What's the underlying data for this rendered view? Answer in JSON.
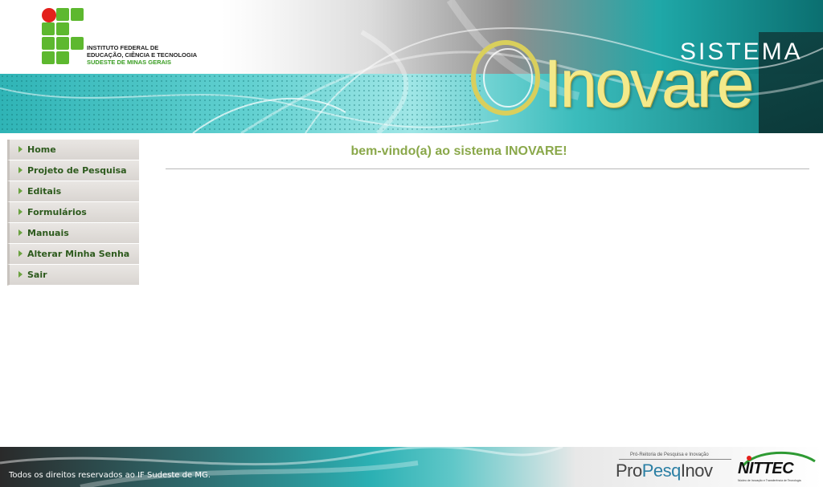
{
  "header": {
    "institution_lines": [
      "INSTITUTO FEDERAL DE",
      "EDUCAÇÃO, CIÊNCIA E TECNOLOGIA",
      "SUDESTE DE MINAS GERAIS"
    ],
    "brand_small": "SISTEMA",
    "brand_large": "Inovare"
  },
  "sidebar": {
    "items": [
      {
        "label": "Home"
      },
      {
        "label": "Projeto de Pesquisa"
      },
      {
        "label": "Editais"
      },
      {
        "label": "Formulários"
      },
      {
        "label": "Manuais"
      },
      {
        "label": "Alterar Minha Senha"
      },
      {
        "label": "Sair"
      }
    ]
  },
  "main": {
    "welcome": "bem-vindo(a) ao sistema INOVARE!"
  },
  "footer": {
    "rights": "Todos os direitos reservados ao IF Sudeste de MG.",
    "propesq_subtitle": "Pró-Reitoria de Pesquisa e Inovação",
    "propesq_pro": "Pro",
    "propesq_pesq": "Pesq",
    "propesq_inov": "Inov",
    "nittec": "NITTEC",
    "nittec_subtitle": "Núcleo de Inovação e Transferência de Tecnologia"
  },
  "colors": {
    "welcome_text": "#8aa84a",
    "nav_text": "#2d5a1d",
    "nav_arrow": "#6aa23f",
    "logo_green": "#5db82f",
    "logo_red": "#e3201b",
    "brand_yellow": "#f3e98a",
    "teal": "#2bb0b3"
  }
}
